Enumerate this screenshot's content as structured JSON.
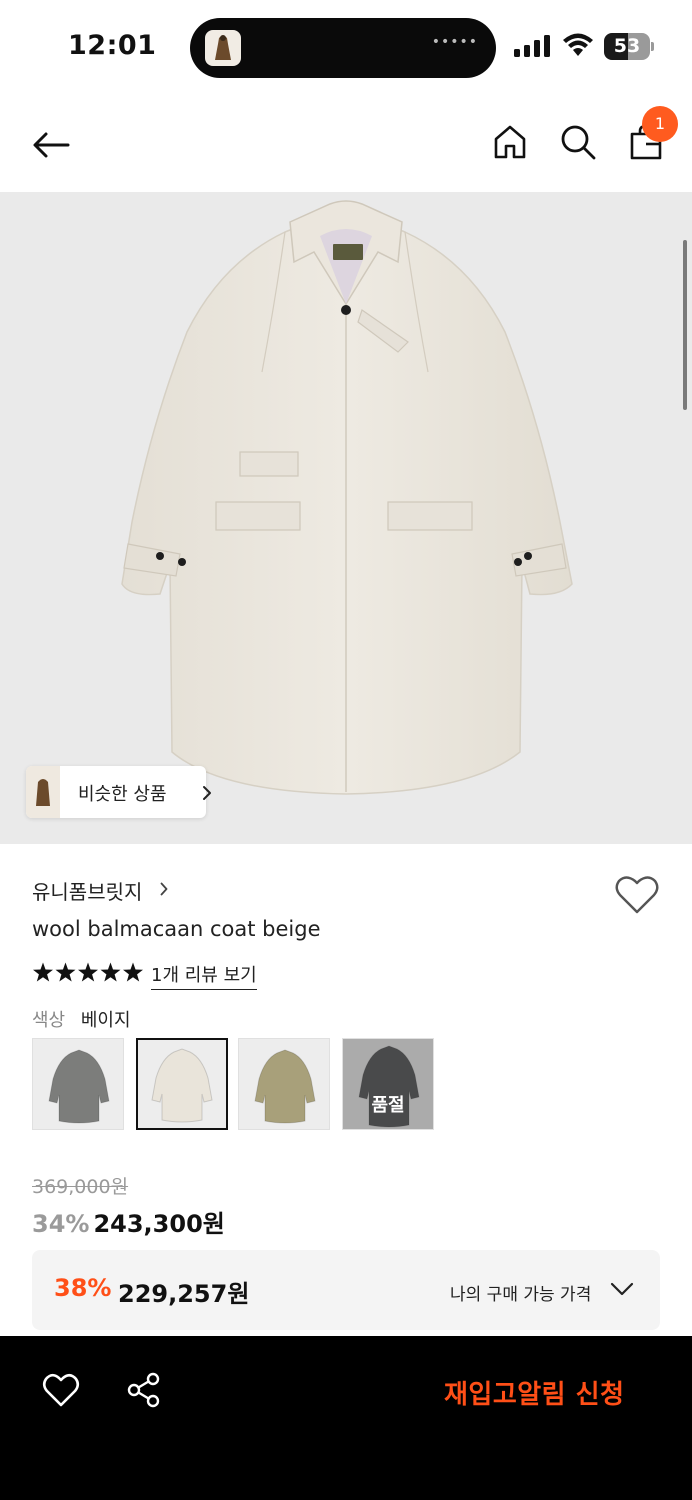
{
  "status_bar": {
    "time": "12:01",
    "island_dots": "•••••",
    "battery": "53",
    "battery_level": 0.53,
    "icons": [
      "signal-icon",
      "wifi-icon",
      "battery-icon"
    ]
  },
  "nav": {
    "icons": [
      "back-arrow-icon",
      "home-icon",
      "search-icon",
      "cart-icon"
    ],
    "cart_count": "1",
    "badge_color": "#ff5b1f"
  },
  "hero": {
    "similar_button_label": "비슷한 상품",
    "icons": [
      "chevron-right-icon"
    ]
  },
  "product": {
    "brand": "유니폼브릿지",
    "name": "wool balmacaan coat beige",
    "rating_stars": 5,
    "review_link": "1개 리뷰 보기",
    "color_label": "색상",
    "color_value": "베이지",
    "swatches": [
      {
        "color": "#7c7d7b",
        "selected": false,
        "soldout": false
      },
      {
        "color": "#e9e4da",
        "selected": true,
        "soldout": false
      },
      {
        "color": "#a8a07a",
        "selected": false,
        "soldout": false
      },
      {
        "color": "#3b3c3e",
        "selected": false,
        "soldout": true,
        "soldout_label": "품절"
      }
    ],
    "wishlist_icon": "heart-outline-icon"
  },
  "price": {
    "original": "369,000원",
    "sale_rate": "34%",
    "sale_price": "243,300원",
    "my_rate": "38%",
    "my_price": "229,257원",
    "my_label": "나의 구매 가능 가격",
    "accent_color": "#ff4f17"
  },
  "bottom_bar": {
    "icons": [
      "heart-outline-icon",
      "share-icon"
    ],
    "restock_label": "재입고알림 신청"
  }
}
